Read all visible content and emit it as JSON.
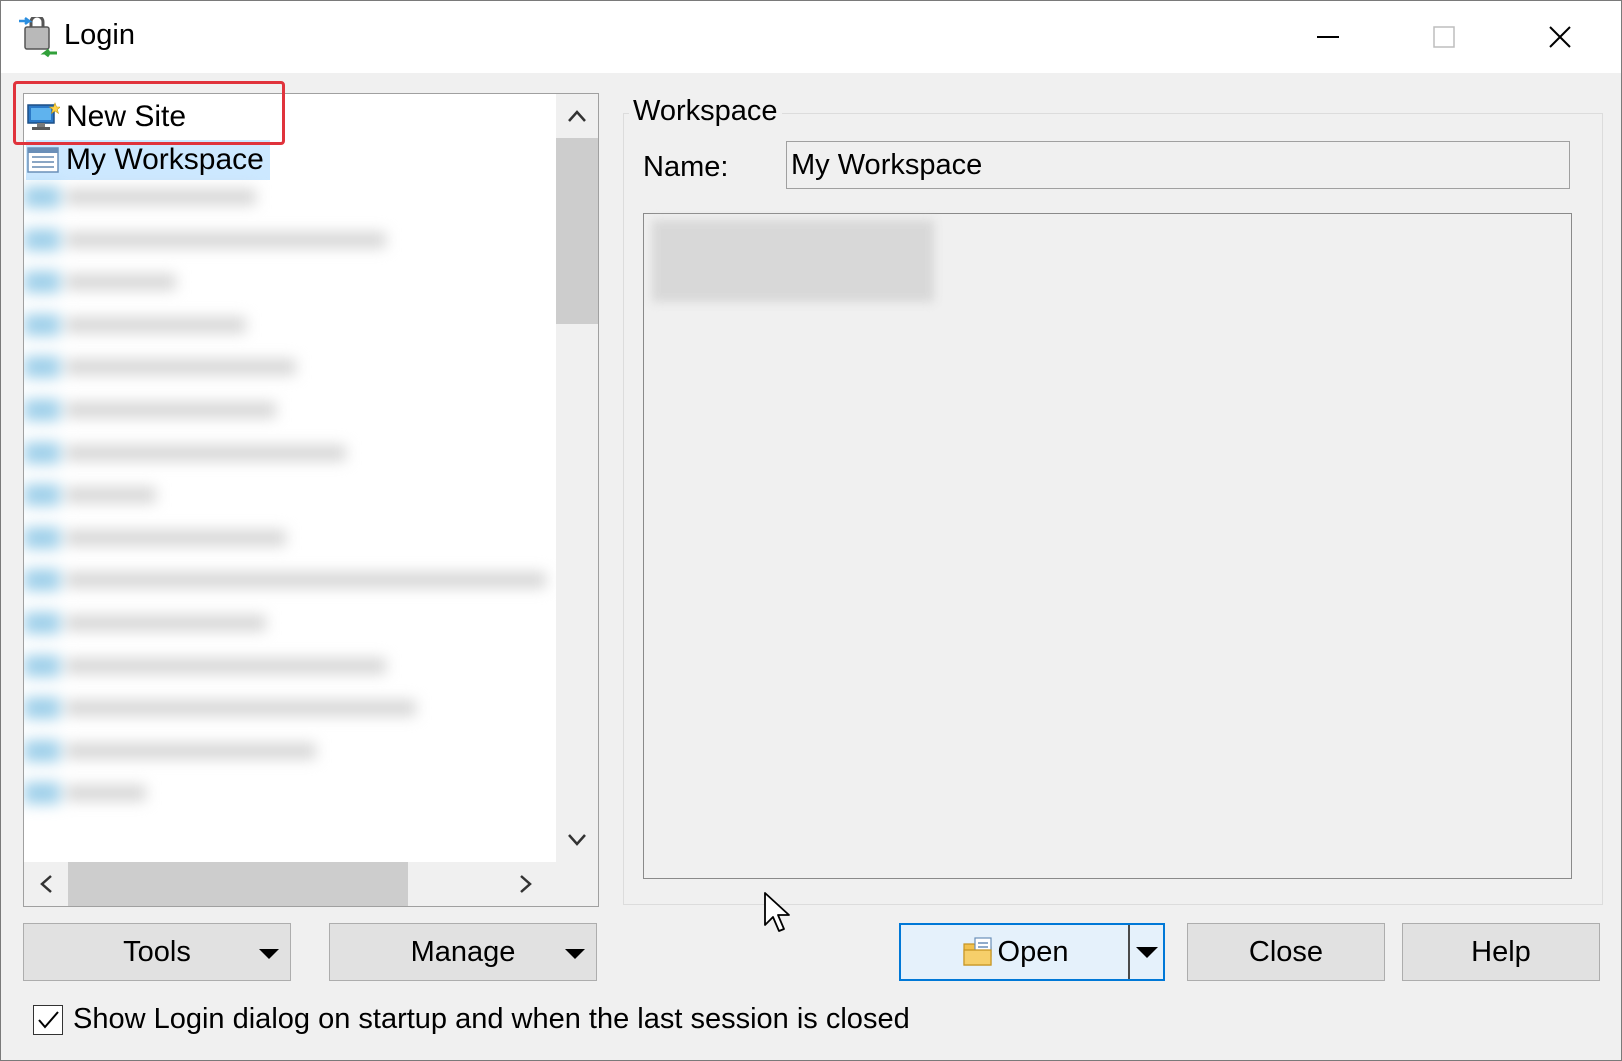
{
  "window": {
    "title": "Login",
    "icon": "login-app-icon",
    "controls": [
      "minimize-icon",
      "maximize-icon",
      "close-icon"
    ]
  },
  "tree": {
    "items": [
      {
        "label": "New Site",
        "icon": "new-site-icon",
        "selected": false,
        "highlighted": true
      },
      {
        "label": "My Workspace",
        "icon": "workspace-icon",
        "selected": true
      }
    ],
    "redacted_row_count": 15
  },
  "workspace": {
    "group_title": "Workspace",
    "name_label": "Name:",
    "name_value": "My Workspace",
    "description_redacted": true
  },
  "buttons": {
    "tools": "Tools",
    "manage": "Manage",
    "open": "Open",
    "close": "Close",
    "help": "Help"
  },
  "startup": {
    "label": "Show Login dialog on startup and when the last session is closed",
    "checked": true
  },
  "colors": {
    "accent": "#0078d7",
    "selection": "#cce8ff",
    "highlight_box": "#e0333c"
  }
}
